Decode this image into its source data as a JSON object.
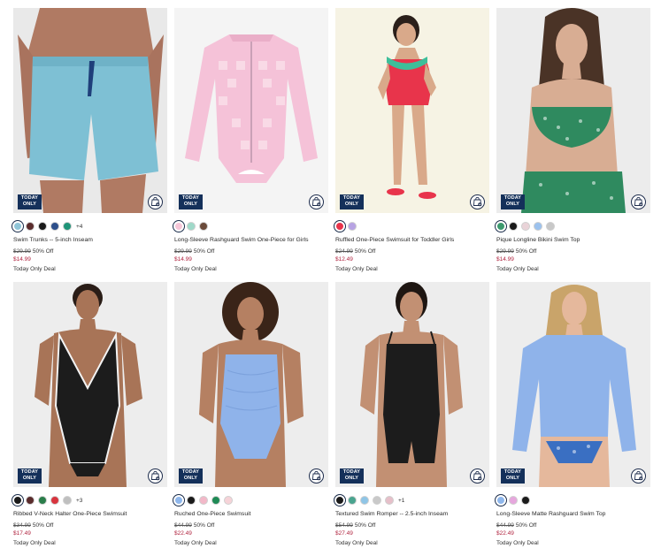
{
  "badge": {
    "line1": "TODAY",
    "line2": "ONLY"
  },
  "products": [
    {
      "name": "Swim Trunks -- 5-inch Inseam",
      "original_price": "$29.99",
      "discount": "50% Off",
      "sale_price": "$14.99",
      "deal": "Today Only Deal",
      "swatches": [
        "#8fc5d8",
        "#5a2c2c",
        "#1a1a1a",
        "#2d4f8a",
        "#1f9478"
      ],
      "more": "+4",
      "bg": "#efefef"
    },
    {
      "name": "Long-Sleeve Rashguard Swim One-Piece for Girls",
      "original_price": "$29.99",
      "discount": "50% Off",
      "sale_price": "$14.99",
      "deal": "Today Only Deal",
      "swatches": [
        "#f6c6d8",
        "#9fd9c9",
        "#6a4a3a"
      ],
      "more": "",
      "bg": "#f4f4f4"
    },
    {
      "name": "Ruffled One-Piece Swimsuit for Toddler Girls",
      "original_price": "$24.99",
      "discount": "50% Off",
      "sale_price": "$12.49",
      "deal": "Today Only Deal",
      "swatches": [
        "#e8344b",
        "#b7a3e3"
      ],
      "more": "",
      "bg": "#f6f3e4"
    },
    {
      "name": "Pique Longline Bikini Swim Top",
      "original_price": "$29.99",
      "discount": "50% Off",
      "sale_price": "$14.99",
      "deal": "Today Only Deal",
      "swatches": [
        "#3d9a6f",
        "#1a1a1a",
        "#e9d3d8",
        "#9cc2ee",
        "#c8c8c8"
      ],
      "more": "",
      "bg": "#efefef"
    },
    {
      "name": "Ribbed V-Neck Halter One-Piece Swimsuit",
      "original_price": "$34.99",
      "discount": "50% Off",
      "sale_price": "$17.49",
      "deal": "Today Only Deal",
      "swatches": [
        "#1a1a1a",
        "#5a2c2c",
        "#2a7d4a",
        "#d8343e",
        "#bfbfbf"
      ],
      "more": "+3",
      "bg": "#efefef"
    },
    {
      "name": "Ruched One-Piece Swimsuit",
      "original_price": "$44.99",
      "discount": "50% Off",
      "sale_price": "$22.49",
      "deal": "Today Only Deal",
      "swatches": [
        "#8fb7ec",
        "#1a1a1a",
        "#f2b8c8",
        "#1e8a55",
        "#f6d3d8"
      ],
      "more": "",
      "bg": "#efefef"
    },
    {
      "name": "Textured Swim Romper -- 2.5-inch Inseam",
      "original_price": "$54.99",
      "discount": "50% Off",
      "sale_price": "$27.49",
      "deal": "Today Only Deal",
      "swatches": [
        "#1a1a1a",
        "#4aa48f",
        "#8fc5e6",
        "#c9c9c9",
        "#e6bfc9"
      ],
      "more": "+1",
      "bg": "#efefef"
    },
    {
      "name": "Long-Sleeve Matte Rashguard Swim Top",
      "original_price": "$44.99",
      "discount": "50% Off",
      "sale_price": "$22.49",
      "deal": "Today Only Deal",
      "swatches": [
        "#8fb7ec",
        "#e6a7dd",
        "#1a1a1a"
      ],
      "more": "",
      "bg": "#efefef"
    }
  ]
}
